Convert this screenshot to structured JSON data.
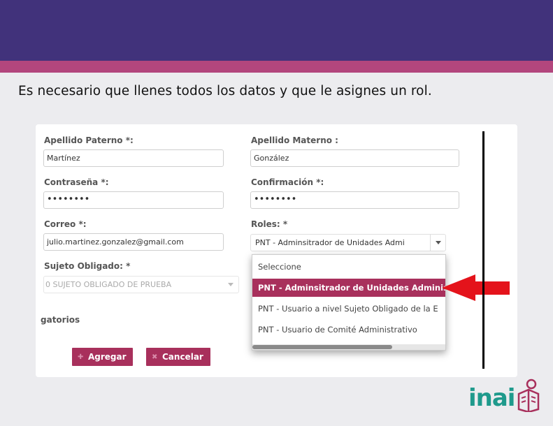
{
  "instruction": "Es necesario que llenes todos los datos y que le asignes un rol.",
  "form": {
    "apellido_paterno_label": "Apellido Paterno *:",
    "apellido_paterno_value": "Martínez",
    "apellido_materno_label": "Apellido Materno :",
    "apellido_materno_value": "González",
    "contrasena_label": "Contraseña *:",
    "contrasena_value": "••••••••",
    "confirmacion_label": "Confirmación *:",
    "confirmacion_value": "••••••••",
    "correo_label": "Correo *:",
    "correo_value": "julio.martinez.gonzalez@gmail.com",
    "roles_label": "Roles: *",
    "roles_value": "PNT - Adminsitrador de Unidades Admi",
    "sujeto_label": "Sujeto Obligado: *",
    "sujeto_value": "0 SUJETO OBLIGADO DE PRUEBA",
    "partial_label": "gatorios"
  },
  "roles_dropdown": {
    "options": [
      "Seleccione",
      "PNT - Adminsitrador de Unidades Administ",
      "PNT - Usuario a nivel Sujeto Obligado de la E",
      "PNT - Usuario de Comité Administrativo"
    ],
    "selected_index": 1
  },
  "buttons": {
    "agregar": "Agregar",
    "cancelar": "Cancelar"
  },
  "logo": {
    "text": "inai"
  },
  "colors": {
    "header": "#41327b",
    "accent": "#b3467d",
    "button": "#a8305c",
    "logo": "#1f9a8c",
    "arrow": "#e4131b"
  }
}
